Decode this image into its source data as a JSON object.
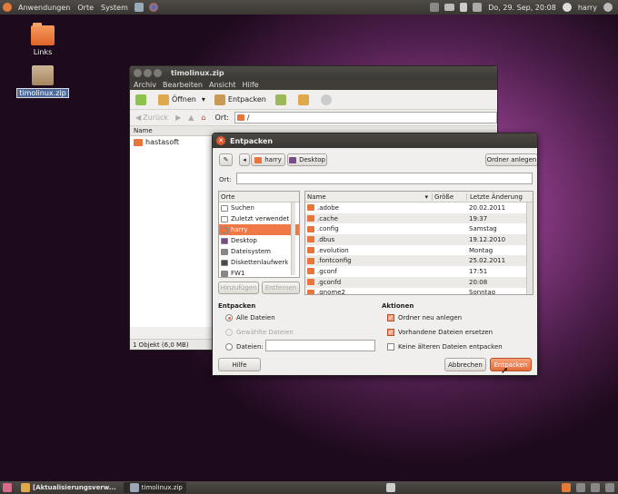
{
  "top_panel": {
    "menus": [
      "Anwendungen",
      "Orte",
      "System"
    ],
    "clock": "Do, 29. Sep, 20:08",
    "user": "harry"
  },
  "desktop_icons": [
    {
      "label": "Links"
    },
    {
      "label": "timolinux.zip"
    }
  ],
  "back_window": {
    "title": "timolinux.zip",
    "menu": [
      "Archiv",
      "Bearbeiten",
      "Ansicht",
      "Hilfe"
    ],
    "toolbar": {
      "open": "Öffnen",
      "extract": "Entpacken"
    },
    "nav": {
      "back": "Zurück"
    },
    "location_label": "Ort:",
    "location_value": "/",
    "column_name": "Name",
    "files": [
      "hastasoft"
    ],
    "status": "1 Objekt (6,0 MB)"
  },
  "dialog": {
    "title": "Entpacken",
    "path_buttons": [
      "harry",
      "Desktop"
    ],
    "create_folder": "Ordner anlegen",
    "location_label": "Ort:",
    "places_header": "Orte",
    "places": [
      {
        "label": "Suchen",
        "icon": "search-icon",
        "color": "#ffffff"
      },
      {
        "label": "Zuletzt verwendet",
        "icon": "clock-icon",
        "color": "#ffffff"
      },
      {
        "label": "harry",
        "icon": "home-folder-icon",
        "color": "#e9743c"
      },
      {
        "label": "Desktop",
        "icon": "desktop-icon",
        "color": "#7a4a8a"
      },
      {
        "label": "Dateisystem",
        "icon": "harddisk-icon",
        "color": "#8a8880"
      },
      {
        "label": "Diskettenlaufwerk",
        "icon": "floppy-icon",
        "color": "#4a4a4a"
      },
      {
        "label": "FW1",
        "icon": "drive-icon",
        "color": "#8a8880"
      }
    ],
    "add_button": "Hinzufügen",
    "remove_button": "Entfernen",
    "file_columns": {
      "name": "Name",
      "size": "Größe",
      "modified": "Letzte Änderung"
    },
    "files": [
      {
        "name": ".adobe",
        "size": "",
        "date": "20.02.2011"
      },
      {
        "name": ".cache",
        "size": "",
        "date": "19:37"
      },
      {
        "name": ".config",
        "size": "",
        "date": "Samstag"
      },
      {
        "name": ".dbus",
        "size": "",
        "date": "19.12.2010"
      },
      {
        "name": ".evolution",
        "size": "",
        "date": "Montag"
      },
      {
        "name": ".fontconfig",
        "size": "",
        "date": "25.02.2011"
      },
      {
        "name": ".gconf",
        "size": "",
        "date": "17:51"
      },
      {
        "name": ".gconfd",
        "size": "",
        "date": "20:08"
      },
      {
        "name": ".gnome2",
        "size": "",
        "date": "Sonntag"
      }
    ],
    "extract_section": {
      "title": "Entpacken",
      "all_files": "Alle Dateien",
      "selected_files": "Gewählte Dateien",
      "files_label": "Dateien:"
    },
    "actions_section": {
      "title": "Aktionen",
      "create_folders": "Ordner neu anlegen",
      "overwrite": "Vorhandene Dateien ersetzen",
      "no_older": "Keine älteren Dateien entpacken"
    },
    "help_button": "Hilfe",
    "cancel_button": "Abbrechen",
    "extract_button": "Entpacken"
  },
  "taskbar": {
    "tasks": [
      "[Aktualisierungsverw...",
      "timolinux.zip"
    ]
  }
}
